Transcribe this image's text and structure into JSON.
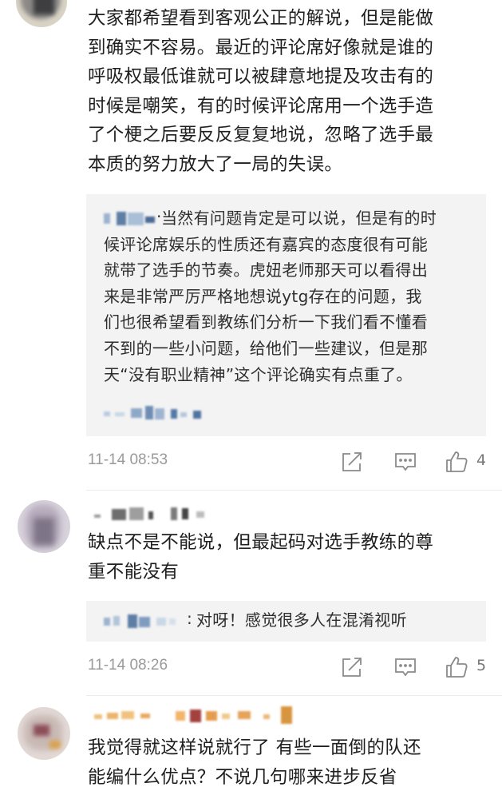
{
  "comments": [
    {
      "text": "大家都希望看到客观公正的解说，但是能做\n到确实不容易。最近的评论席好像就是谁的\n呼吸权最低谁就可以被肆意地提及攻击有的\n时候是嘲笑，有的时候评论席用一个选手造\n了个梗之后要反反复复地说，忽略了选手最\n本质的努力放大了一局的失误。",
      "reply": {
        "separator": ".",
        "text": "当然有问题肯定是可以说，但是有的时\n候评论席娱乐的性质还有嘉宾的态度很有可能\n就带了选手的节奏。虎妞老师那天可以看得出\n来是非常严厉严格地想说ytg存在的问题，我\n们也很希望看到教练们分析一下我们看不懂看\n不到的一些小问题，给他们一些建议，但是那\n天“没有职业精神”这个评论确实有点重了。"
      },
      "timestamp": "11-14 08:53",
      "likes": "4"
    },
    {
      "text": "缺点不是不能说，但最起码对选手教练的尊\n重不能没有",
      "reply": {
        "separator": ":",
        "text": "对呀！感觉很多人在混淆视听"
      },
      "timestamp": "11-14 08:26",
      "likes": "5"
    },
    {
      "text": "我觉得就这样说就行了 有些一面倒的队还\n能编什么优点？不说几句哪来进步反省"
    }
  ],
  "icons": {
    "share": "share-icon",
    "comment": "comment-icon",
    "like": "thumbs-up-icon"
  },
  "colors": {
    "reply_bg": "#f3f3f3",
    "meta_gray": "#9a9a9a",
    "icon_gray": "#8a8a8a"
  }
}
